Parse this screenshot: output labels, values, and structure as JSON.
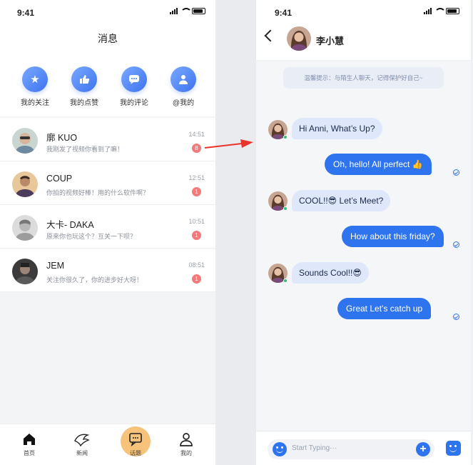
{
  "status_bar": {
    "time": "9:41"
  },
  "left": {
    "title": "消息",
    "quick_actions": [
      {
        "label": "我的关注",
        "icon": "star-icon"
      },
      {
        "label": "我的点赞",
        "icon": "thumbs-up-icon"
      },
      {
        "label": "我的评论",
        "icon": "comment-icon"
      },
      {
        "label": "@我的",
        "icon": "user-icon"
      }
    ],
    "conversations": [
      {
        "name": "廓 KUO",
        "message": "我刚发了视频你看到了嘛！",
        "time": "14:51",
        "unread": "8"
      },
      {
        "name": "COUP",
        "message": "你拍的视频好棒！用的什么软件啊？",
        "time": "12:51",
        "unread": "1"
      },
      {
        "name": "大卡- DAKA",
        "message": "原来你也玩这个？互关一下呗？",
        "time": "10:51",
        "unread": "1"
      },
      {
        "name": "JEM",
        "message": "关注你很久了，你的进步好大呀！",
        "time": "08:51",
        "unread": "1"
      }
    ],
    "tabs": [
      {
        "label": "首页",
        "icon": "home-icon"
      },
      {
        "label": "新闻",
        "icon": "news-icon"
      },
      {
        "label": "话题",
        "icon": "chat-bubble-icon"
      },
      {
        "label": "我的",
        "icon": "profile-icon"
      }
    ]
  },
  "right": {
    "contact_name": "李小慧",
    "notice": "温馨提示：与陌生人聊天，记得保护好自己~",
    "messages": [
      {
        "from": "them",
        "text": "Hi Anni, What’s Up?"
      },
      {
        "from": "me",
        "text": "Oh, hello! All perfect 👍"
      },
      {
        "from": "them",
        "text": "COOL!!😎 Let’s Meet?"
      },
      {
        "from": "me",
        "text": "How about this friday?"
      },
      {
        "from": "them",
        "text": "Sounds Cool!!😎"
      },
      {
        "from": "me",
        "text": "Great Let’s catch up"
      }
    ],
    "input_placeholder": "Start Typing···"
  },
  "colors": {
    "accent": "#2f74ef",
    "incoming_bubble": "#dfe8fb",
    "badge": "#f27a7a",
    "arrow": "#e8342a",
    "center_tab": "#f7c27a"
  }
}
